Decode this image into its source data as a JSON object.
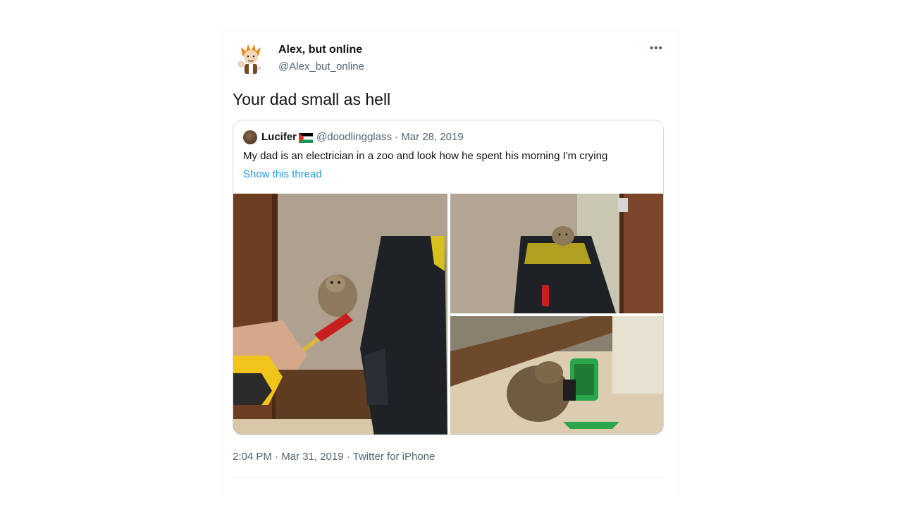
{
  "tweet": {
    "author_name": "Alex, but online",
    "author_handle": "@Alex_but_online",
    "more_icon": "ellipsis-icon",
    "text": "Your dad small as hell",
    "footer": "2:04 PM · Mar 31, 2019 · Twitter for iPhone"
  },
  "quoted": {
    "name": "Lucifer",
    "meta": "@doodlingglass · Mar 28, 2019",
    "text": "My dad is an electrician in a zoo and look how he spent his morning I'm crying",
    "show_thread": "Show this thread",
    "photos": [
      "meerkat-with-screwdriver-photo",
      "meerkat-in-tool-bag-photo",
      "meerkat-with-green-lamp-photo"
    ]
  },
  "colors": {
    "link": "#1d9bf0",
    "secondary_text": "#536471",
    "border": "#cfd9de"
  }
}
